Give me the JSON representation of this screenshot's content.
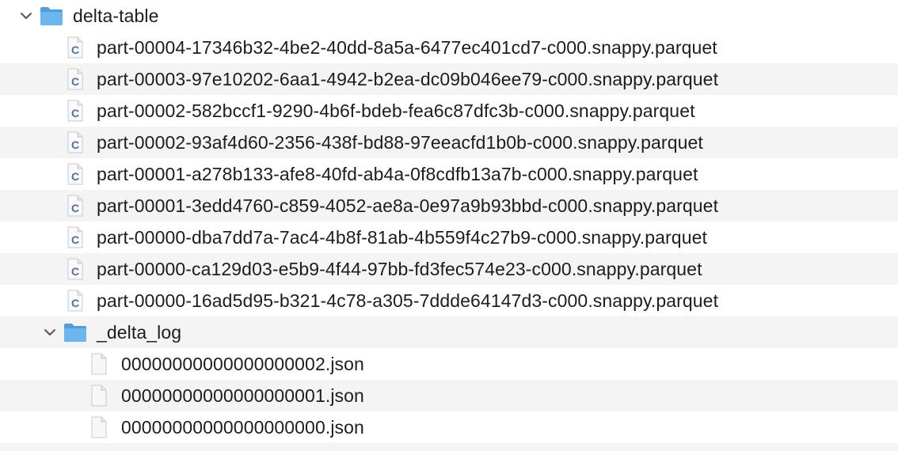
{
  "root": {
    "name": "delta-table",
    "expanded": true,
    "files": [
      "part-00004-17346b32-4be2-40dd-8a5a-6477ec401cd7-c000.snappy.parquet",
      "part-00003-97e10202-6aa1-4942-b2ea-dc09b046ee79-c000.snappy.parquet",
      "part-00002-582bccf1-9290-4b6f-bdeb-fea6c87dfc3b-c000.snappy.parquet",
      "part-00002-93af4d60-2356-438f-bd88-97eeacfd1b0b-c000.snappy.parquet",
      "part-00001-a278b133-afe8-40fd-ab4a-0f8cdfb13a7b-c000.snappy.parquet",
      "part-00001-3edd4760-c859-4052-ae8a-0e97a9b93bbd-c000.snappy.parquet",
      "part-00000-dba7dd7a-7ac4-4b8f-81ab-4b559f4c27b9-c000.snappy.parquet",
      "part-00000-ca129d03-e5b9-4f44-97bb-fd3fec574e23-c000.snappy.parquet",
      "part-00000-16ad5d95-b321-4c78-a305-7ddde64147d3-c000.snappy.parquet"
    ],
    "subfolder": {
      "name": "_delta_log",
      "expanded": true,
      "files": [
        "00000000000000000002.json",
        "00000000000000000001.json",
        "00000000000000000000.json"
      ]
    }
  },
  "icons": {
    "folder": "folder-icon",
    "parquet_file": "c-file-icon",
    "json_file": "document-icon",
    "chevron": "chevron-down-icon"
  },
  "colors": {
    "folder_blue": "#5aa8e6",
    "stripe": "#f4f4f5",
    "text": "#1d1d1f",
    "c_letter": "#4a6fa5"
  }
}
